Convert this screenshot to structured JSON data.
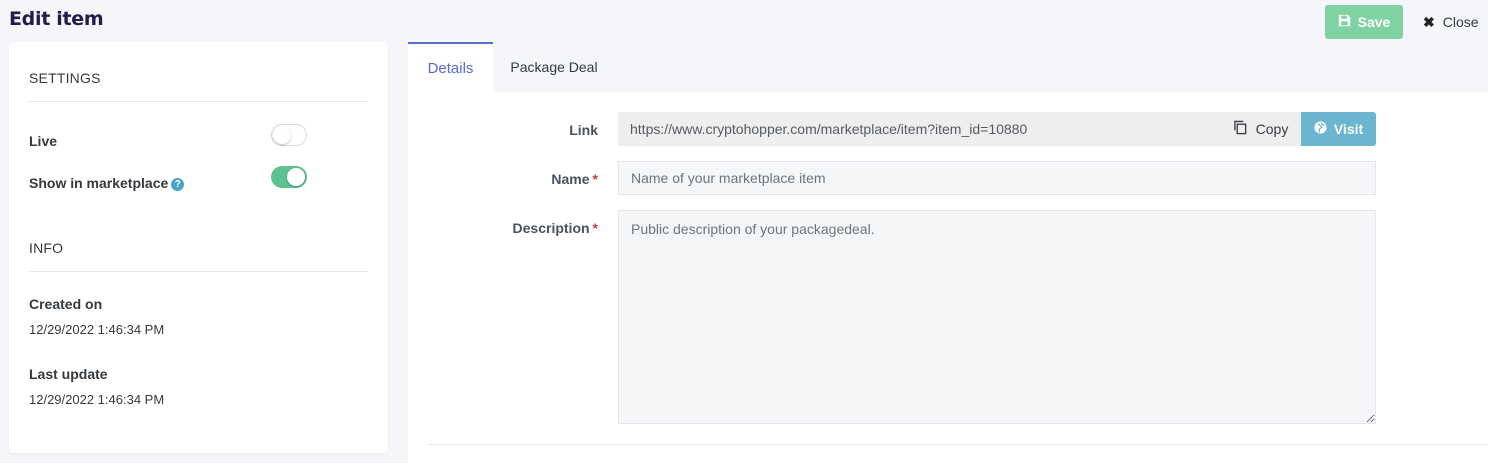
{
  "header": {
    "title": "Edit item",
    "save_label": "Save",
    "close_label": "Close",
    "save_color": "#7fd3a2"
  },
  "settings": {
    "heading": "SETTINGS",
    "live_label": "Live",
    "live_on": false,
    "marketplace_label": "Show in marketplace",
    "marketplace_on": true,
    "toggle_on_color": "#5ec28f"
  },
  "info": {
    "heading": "INFO",
    "created_label": "Created on",
    "created_value": "12/29/2022 1:46:34 PM",
    "updated_label": "Last update",
    "updated_value": "12/29/2022 1:46:34 PM"
  },
  "tabs": [
    {
      "label": "Details",
      "active": true
    },
    {
      "label": "Package Deal",
      "active": false
    }
  ],
  "form": {
    "link_label": "Link",
    "link_value": "https://www.cryptohopper.com/marketplace/item?item_id=10880",
    "copy_label": "Copy",
    "visit_label": "Visit",
    "name_label": "Name",
    "name_placeholder": "Name of your marketplace item",
    "description_label": "Description",
    "description_placeholder": "Public description of your packagedeal.",
    "required_mark": "*",
    "accent_color": "#5a6bd0",
    "visit_color": "#6cb5ce"
  }
}
